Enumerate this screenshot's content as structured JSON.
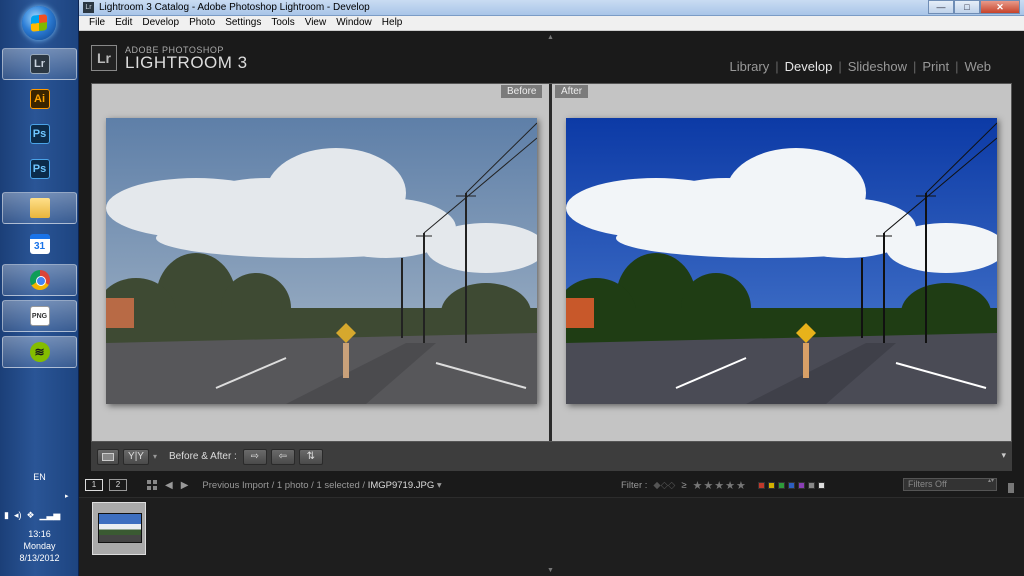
{
  "window": {
    "title": "Lightroom 3 Catalog - Adobe Photoshop Lightroom - Develop",
    "app_icon": "Lr",
    "minimize": "—",
    "maximize": "□",
    "close": "✕"
  },
  "menu": [
    "File",
    "Edit",
    "Develop",
    "Photo",
    "Settings",
    "Tools",
    "View",
    "Window",
    "Help"
  ],
  "identity": {
    "badge": "Lr",
    "line1": "ADOBE PHOTOSHOP",
    "line2": "LIGHTROOM 3"
  },
  "modules": [
    "Library",
    "Develop",
    "Slideshow",
    "Print",
    "Web"
  ],
  "active_module": "Develop",
  "view": {
    "before_label": "Before",
    "after_label": "After"
  },
  "toolbar": {
    "loupe_icon": "loupe-view-icon",
    "yy_label": "Y|Y",
    "before_after_label": "Before & After :",
    "copy_before_to_after": "⇨",
    "copy_after_to_before": "⇦",
    "swap": "⇅",
    "menu_caret": "▾"
  },
  "filmbar": {
    "screen1": "1",
    "screen2": "2",
    "source_path": "Previous Import / 1 photo / 1 selected / ",
    "filename": "IMGP9719.JPG",
    "filter_label": "Filter :",
    "rating_op": "≥",
    "stars": [
      "★",
      "★",
      "★",
      "★",
      "★"
    ],
    "filters_dropdown": "Filters Off",
    "color_labels": [
      "#c0392b",
      "#d4b000",
      "#2e9b3a",
      "#2d5fc0",
      "#8a3fb5",
      "#888888",
      "#dddddd"
    ]
  },
  "taskbar": {
    "apps": [
      {
        "name": "lightroom",
        "label": "Lr",
        "active": true
      },
      {
        "name": "illustrator",
        "label": "Ai",
        "active": false
      },
      {
        "name": "photoshop-1",
        "label": "Ps",
        "active": false
      },
      {
        "name": "photoshop-2",
        "label": "Ps",
        "active": false
      },
      {
        "name": "explorer",
        "label": "",
        "active": true
      },
      {
        "name": "calendar",
        "label": "31",
        "active": false
      },
      {
        "name": "chrome",
        "label": "",
        "active": true
      },
      {
        "name": "document",
        "label": "PNG",
        "active": true
      },
      {
        "name": "spotify",
        "label": "≋",
        "active": true
      }
    ],
    "language": "EN",
    "time": "13:16",
    "day": "Monday",
    "date": "8/13/2012"
  }
}
